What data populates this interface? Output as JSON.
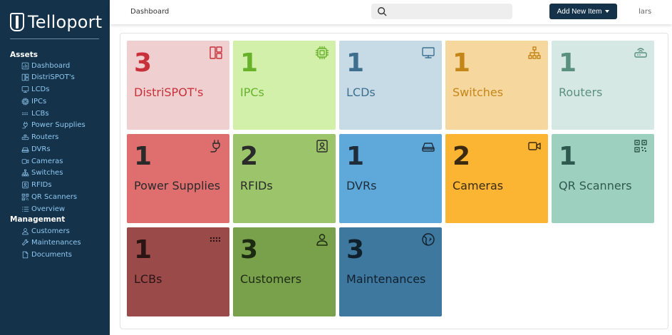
{
  "brand": {
    "name": "Telloport"
  },
  "sidebar": {
    "assets_title": "Assets",
    "assets": [
      {
        "label": "Dashboard",
        "icon": "dashboard-icon"
      },
      {
        "label": "DistriSPOT's",
        "icon": "layout-icon"
      },
      {
        "label": "LCDs",
        "icon": "monitor-icon"
      },
      {
        "label": "IPCs",
        "icon": "cpu-icon"
      },
      {
        "label": "LCBs",
        "icon": "dots-icon"
      },
      {
        "label": "Power Supplies",
        "icon": "plug-icon"
      },
      {
        "label": "Routers",
        "icon": "router-icon"
      },
      {
        "label": "DVRs",
        "icon": "hdd-icon"
      },
      {
        "label": "Cameras",
        "icon": "camera-icon"
      },
      {
        "label": "Switches",
        "icon": "network-icon"
      },
      {
        "label": "RFIDs",
        "icon": "badge-icon"
      },
      {
        "label": "QR Scanners",
        "icon": "qr-icon"
      },
      {
        "label": "Overview",
        "icon": "list-icon"
      }
    ],
    "management_title": "Management",
    "management": [
      {
        "label": "Customers",
        "icon": "person-icon"
      },
      {
        "label": "Maintenances",
        "icon": "wrench-icon"
      },
      {
        "label": "Documents",
        "icon": "file-icon"
      }
    ]
  },
  "topbar": {
    "breadcrumb": "Dashboard",
    "search_placeholder": "",
    "add_button_label": "Add New Item",
    "user": "lars"
  },
  "cards": [
    {
      "count": "3",
      "label": "DistriSPOT's",
      "icon": "layout-icon",
      "bg": "#f0cfd0",
      "fg": "#c8313a"
    },
    {
      "count": "1",
      "label": "IPCs",
      "icon": "cpu-icon",
      "bg": "#d2f0aa",
      "fg": "#67b22a"
    },
    {
      "count": "1",
      "label": "LCDs",
      "icon": "monitor-icon",
      "bg": "#c7dbe7",
      "fg": "#3e6f8f"
    },
    {
      "count": "1",
      "label": "Switches",
      "icon": "network-icon",
      "bg": "#f6d89e",
      "fg": "#c58619"
    },
    {
      "count": "1",
      "label": "Routers",
      "icon": "router-icon",
      "bg": "#d6e8e3",
      "fg": "#5b907f"
    },
    {
      "count": "1",
      "label": "Power Supplies",
      "icon": "plug-icon",
      "bg": "#df6e6f",
      "fg": "#2a2a2a"
    },
    {
      "count": "2",
      "label": "RFIDs",
      "icon": "badge-icon",
      "bg": "#9bc46b",
      "fg": "#2a2a2a"
    },
    {
      "count": "1",
      "label": "DVRs",
      "icon": "hdd-icon",
      "bg": "#5ea8da",
      "fg": "#1f2d3a"
    },
    {
      "count": "2",
      "label": "Cameras",
      "icon": "camera-icon",
      "bg": "#fbb533",
      "fg": "#3a2a10"
    },
    {
      "count": "1",
      "label": "QR Scanners",
      "icon": "qr-icon",
      "bg": "#9ed0c0",
      "fg": "#2d5a4c"
    },
    {
      "count": "1",
      "label": "LCBs",
      "icon": "dots-icon",
      "bg": "#9b4a4a",
      "fg": "#2a1414"
    },
    {
      "count": "3",
      "label": "Customers",
      "icon": "person-icon",
      "bg": "#79a14c",
      "fg": "#1d2a12"
    },
    {
      "count": "3",
      "label": "Maintenances",
      "icon": "globe-wrench-icon",
      "bg": "#3e789e",
      "fg": "#0f1f2c"
    }
  ]
}
